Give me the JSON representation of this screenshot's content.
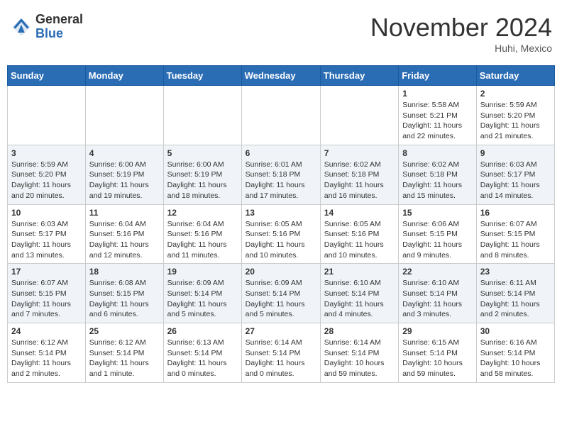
{
  "header": {
    "logo_general": "General",
    "logo_blue": "Blue",
    "month_title": "November 2024",
    "location": "Huhi, Mexico"
  },
  "weekdays": [
    "Sunday",
    "Monday",
    "Tuesday",
    "Wednesday",
    "Thursday",
    "Friday",
    "Saturday"
  ],
  "weeks": [
    [
      {
        "day": "",
        "info": ""
      },
      {
        "day": "",
        "info": ""
      },
      {
        "day": "",
        "info": ""
      },
      {
        "day": "",
        "info": ""
      },
      {
        "day": "",
        "info": ""
      },
      {
        "day": "1",
        "info": "Sunrise: 5:58 AM\nSunset: 5:21 PM\nDaylight: 11 hours and 22 minutes."
      },
      {
        "day": "2",
        "info": "Sunrise: 5:59 AM\nSunset: 5:20 PM\nDaylight: 11 hours and 21 minutes."
      }
    ],
    [
      {
        "day": "3",
        "info": "Sunrise: 5:59 AM\nSunset: 5:20 PM\nDaylight: 11 hours and 20 minutes."
      },
      {
        "day": "4",
        "info": "Sunrise: 6:00 AM\nSunset: 5:19 PM\nDaylight: 11 hours and 19 minutes."
      },
      {
        "day": "5",
        "info": "Sunrise: 6:00 AM\nSunset: 5:19 PM\nDaylight: 11 hours and 18 minutes."
      },
      {
        "day": "6",
        "info": "Sunrise: 6:01 AM\nSunset: 5:18 PM\nDaylight: 11 hours and 17 minutes."
      },
      {
        "day": "7",
        "info": "Sunrise: 6:02 AM\nSunset: 5:18 PM\nDaylight: 11 hours and 16 minutes."
      },
      {
        "day": "8",
        "info": "Sunrise: 6:02 AM\nSunset: 5:18 PM\nDaylight: 11 hours and 15 minutes."
      },
      {
        "day": "9",
        "info": "Sunrise: 6:03 AM\nSunset: 5:17 PM\nDaylight: 11 hours and 14 minutes."
      }
    ],
    [
      {
        "day": "10",
        "info": "Sunrise: 6:03 AM\nSunset: 5:17 PM\nDaylight: 11 hours and 13 minutes."
      },
      {
        "day": "11",
        "info": "Sunrise: 6:04 AM\nSunset: 5:16 PM\nDaylight: 11 hours and 12 minutes."
      },
      {
        "day": "12",
        "info": "Sunrise: 6:04 AM\nSunset: 5:16 PM\nDaylight: 11 hours and 11 minutes."
      },
      {
        "day": "13",
        "info": "Sunrise: 6:05 AM\nSunset: 5:16 PM\nDaylight: 11 hours and 10 minutes."
      },
      {
        "day": "14",
        "info": "Sunrise: 6:05 AM\nSunset: 5:16 PM\nDaylight: 11 hours and 10 minutes."
      },
      {
        "day": "15",
        "info": "Sunrise: 6:06 AM\nSunset: 5:15 PM\nDaylight: 11 hours and 9 minutes."
      },
      {
        "day": "16",
        "info": "Sunrise: 6:07 AM\nSunset: 5:15 PM\nDaylight: 11 hours and 8 minutes."
      }
    ],
    [
      {
        "day": "17",
        "info": "Sunrise: 6:07 AM\nSunset: 5:15 PM\nDaylight: 11 hours and 7 minutes."
      },
      {
        "day": "18",
        "info": "Sunrise: 6:08 AM\nSunset: 5:15 PM\nDaylight: 11 hours and 6 minutes."
      },
      {
        "day": "19",
        "info": "Sunrise: 6:09 AM\nSunset: 5:14 PM\nDaylight: 11 hours and 5 minutes."
      },
      {
        "day": "20",
        "info": "Sunrise: 6:09 AM\nSunset: 5:14 PM\nDaylight: 11 hours and 5 minutes."
      },
      {
        "day": "21",
        "info": "Sunrise: 6:10 AM\nSunset: 5:14 PM\nDaylight: 11 hours and 4 minutes."
      },
      {
        "day": "22",
        "info": "Sunrise: 6:10 AM\nSunset: 5:14 PM\nDaylight: 11 hours and 3 minutes."
      },
      {
        "day": "23",
        "info": "Sunrise: 6:11 AM\nSunset: 5:14 PM\nDaylight: 11 hours and 2 minutes."
      }
    ],
    [
      {
        "day": "24",
        "info": "Sunrise: 6:12 AM\nSunset: 5:14 PM\nDaylight: 11 hours and 2 minutes."
      },
      {
        "day": "25",
        "info": "Sunrise: 6:12 AM\nSunset: 5:14 PM\nDaylight: 11 hours and 1 minute."
      },
      {
        "day": "26",
        "info": "Sunrise: 6:13 AM\nSunset: 5:14 PM\nDaylight: 11 hours and 0 minutes."
      },
      {
        "day": "27",
        "info": "Sunrise: 6:14 AM\nSunset: 5:14 PM\nDaylight: 11 hours and 0 minutes."
      },
      {
        "day": "28",
        "info": "Sunrise: 6:14 AM\nSunset: 5:14 PM\nDaylight: 10 hours and 59 minutes."
      },
      {
        "day": "29",
        "info": "Sunrise: 6:15 AM\nSunset: 5:14 PM\nDaylight: 10 hours and 59 minutes."
      },
      {
        "day": "30",
        "info": "Sunrise: 6:16 AM\nSunset: 5:14 PM\nDaylight: 10 hours and 58 minutes."
      }
    ]
  ]
}
